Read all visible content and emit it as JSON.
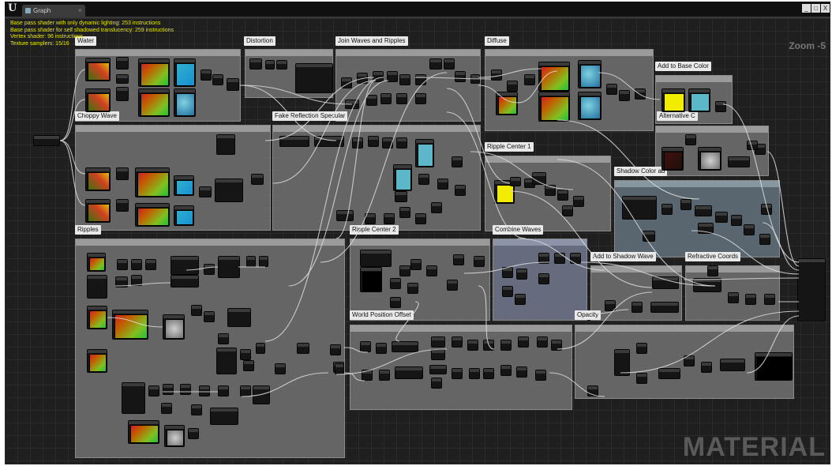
{
  "window": {
    "tab_label": "Graph",
    "tab_close": "×",
    "controls": [
      "_",
      "□",
      "X"
    ]
  },
  "stats": {
    "lines": [
      "Base pass shader with only dynamic lighting: 253 instructions",
      "Base pass shader for self shadowed translucency: 259 instructions",
      "Vertex shader: 96 instructions",
      "Texture samplers: 15/16"
    ]
  },
  "zoom_label": "Zoom -5",
  "watermark": "MATERIAL",
  "comments": {
    "water": "Water",
    "distortion": "Distortion",
    "join_waves": "Join Waves and Ripples",
    "diffuse": "Diffuse",
    "add_base_color": "Add to Base Color",
    "alternative": "Alternative C",
    "choppy_wave": "Choppy Wave",
    "fake_reflection": "Fake Reflection Specular",
    "ripple_center_1": "Ripple Center 1",
    "shadow_color": "Shadow Color ad",
    "ripples": "Ripples",
    "ripple_center_2": "Ripple Center 2",
    "combine_waves": "Combine Waves",
    "add_shadow_wave": "Add to Shadow Wave",
    "refraction_coords": "Refractive Coords",
    "world_position_offset": "World Position Offset",
    "opacity": "Opacity"
  },
  "colors": {
    "stats_text": "#e6e600",
    "comment_bg": "#707070",
    "blue_comment_bg": "#6e7387",
    "graph_bg": "#1f1f1f"
  },
  "icons": {
    "logo": "unreal-engine-logo"
  }
}
